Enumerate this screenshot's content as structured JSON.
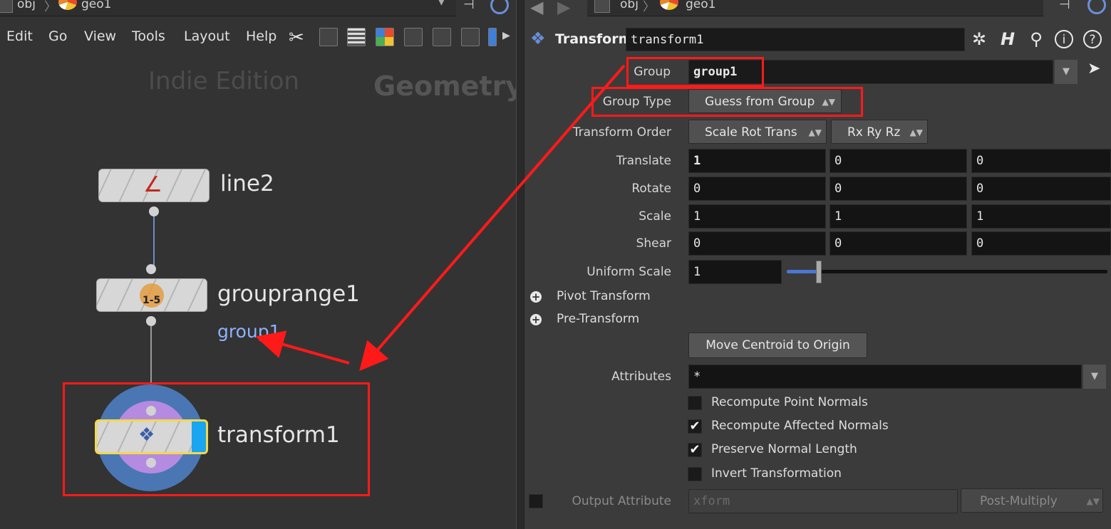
{
  "left": {
    "path": {
      "obj": "obj",
      "geo": "geo1"
    },
    "menu": [
      "Edit",
      "Go",
      "View",
      "Tools",
      "Layout",
      "Help"
    ],
    "watermark_left": "Indie Edition",
    "watermark_right": "Geometry",
    "nodes": {
      "line": "line2",
      "grouprange": "grouprange1",
      "group_flag": "group1",
      "transform": "transform1",
      "grouprange_icon_text": "1-5"
    }
  },
  "right": {
    "path": {
      "obj": "obj",
      "geo": "geo1"
    },
    "node_type": "Transform",
    "node_name": "transform1",
    "labels": {
      "group": "Group",
      "group_type": "Group Type",
      "transform_order": "Transform Order",
      "translate": "Translate",
      "rotate": "Rotate",
      "scale": "Scale",
      "shear": "Shear",
      "uniform_scale": "Uniform Scale",
      "pivot_transform": "Pivot Transform",
      "pre_transform": "Pre-Transform",
      "attributes": "Attributes",
      "output_attribute": "Output Attribute"
    },
    "values": {
      "group": "group1",
      "group_type": "Guess from Group",
      "transform_order": "Scale Rot Trans",
      "rotate_order": "Rx Ry Rz",
      "translate": [
        "1",
        "0",
        "0"
      ],
      "rotate": [
        "0",
        "0",
        "0"
      ],
      "scale": [
        "1",
        "1",
        "1"
      ],
      "shear": [
        "0",
        "0",
        "0"
      ],
      "uniform_scale": "1",
      "uniform_scale_slider_fraction": 0.1,
      "attributes": "*",
      "output_attribute_placeholder": "xform",
      "output_mode": "Post-Multiply"
    },
    "buttons": {
      "move_centroid": "Move Centroid to Origin"
    },
    "checkboxes": [
      {
        "label": "Recompute Point Normals",
        "checked": false
      },
      {
        "label": "Recompute Affected Normals",
        "checked": true
      },
      {
        "label": "Preserve Normal Length",
        "checked": true
      },
      {
        "label": "Invert Transformation",
        "checked": false
      }
    ],
    "check_glyph": "✔",
    "icons": [
      "gear-icon",
      "houdini-help-icon",
      "search-icon",
      "info-icon",
      "help-icon"
    ]
  },
  "colors": {
    "annotation": "#ff1a1a",
    "selected_outline": "#f5d84a",
    "group_text": "#8fb3ff"
  }
}
